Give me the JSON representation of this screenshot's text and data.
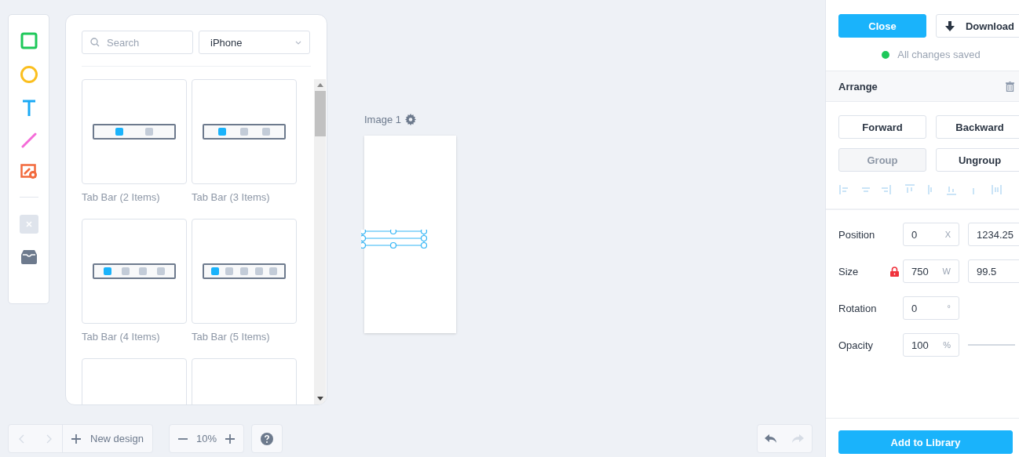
{
  "tools": [
    {
      "kind": "rectangle"
    },
    {
      "kind": "ellipse"
    },
    {
      "kind": "text"
    },
    {
      "kind": "line"
    },
    {
      "kind": "image"
    },
    {
      "kind": "divider"
    },
    {
      "kind": "delete",
      "disabled": true
    },
    {
      "kind": "inbox"
    }
  ],
  "library": {
    "search": {
      "placeholder": "Search"
    },
    "device": "iPhone",
    "cards": [
      {
        "kind": "tab_bar",
        "label": "Tab Bar (2 Items)",
        "dots": [
          {
            "selected": true
          },
          {
            "selected": false
          }
        ]
      },
      {
        "kind": "tab_bar",
        "label": "Tab Bar (3 Items)",
        "dots": [
          {
            "selected": true
          },
          {
            "selected": false
          },
          {
            "selected": false
          }
        ]
      },
      {
        "kind": "tab_bar",
        "label": "Tab Bar (4 Items)",
        "dots": [
          {
            "selected": true
          },
          {
            "selected": false
          },
          {
            "selected": false
          },
          {
            "selected": false
          }
        ]
      },
      {
        "kind": "tab_bar",
        "label": "Tab Bar (5 Items)",
        "dots": [
          {
            "selected": true
          },
          {
            "selected": false
          },
          {
            "selected": false
          },
          {
            "selected": false
          },
          {
            "selected": false
          }
        ]
      },
      {
        "kind": "blank"
      },
      {
        "kind": "blank"
      }
    ]
  },
  "canvas": {
    "artboard_title": "Image 1"
  },
  "bottom_bar": {
    "back_disabled": true,
    "forward_disabled": true,
    "new_design": "New design",
    "zoom": "10%",
    "undo_disabled": false,
    "redo_disabled": true
  },
  "panel": {
    "close": "Close",
    "download": "Download",
    "status": {
      "text": "All changes saved",
      "color": "#1ec85a"
    },
    "section": "Arrange",
    "buttons": [
      {
        "label": "Forward",
        "disabled": false
      },
      {
        "label": "Backward",
        "disabled": false
      },
      {
        "label": "Group",
        "disabled": true
      },
      {
        "label": "Ungroup",
        "disabled": false
      }
    ],
    "properties": [
      {
        "kind": "pair",
        "label": "Position",
        "locked": false,
        "fields": [
          {
            "value": "0",
            "unit": "X"
          },
          {
            "value": "1234.25"
          }
        ]
      },
      {
        "kind": "pair",
        "label": "Size",
        "locked": true,
        "fields": [
          {
            "value": "750",
            "unit": "W"
          },
          {
            "value": "99.5"
          }
        ]
      },
      {
        "kind": "single",
        "label": "Rotation",
        "locked": false,
        "fields": [
          {
            "value": "0",
            "unit": "°"
          }
        ]
      },
      {
        "kind": "slider",
        "label": "Opacity",
        "locked": false,
        "level": 1,
        "fields": [
          {
            "value": "100",
            "unit": "%"
          }
        ]
      }
    ],
    "add": "Add to Library"
  }
}
